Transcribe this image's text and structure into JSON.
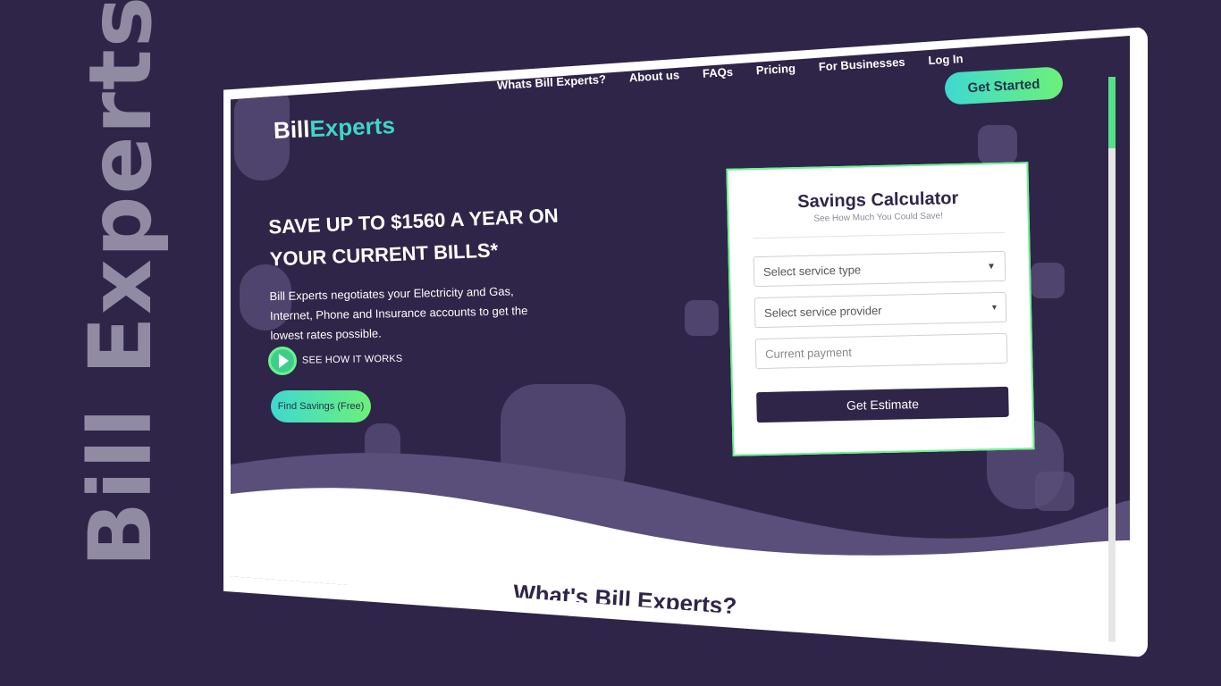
{
  "side_title": "Bill Experts",
  "logo": {
    "part1": "Bill",
    "part2": "Experts"
  },
  "nav": {
    "items": [
      "Whats Bill Experts?",
      "About us",
      "FAQs",
      "Pricing",
      "For Businesses",
      "Log In"
    ],
    "cta": "Get Started"
  },
  "hero": {
    "headline": "SAVE UP TO $1560 A YEAR ON YOUR CURRENT BILLS*",
    "description": "Bill Experts negotiates your Electricity and Gas, Internet, Phone and Insurance accounts to get the lowest rates possible.",
    "play_label": "SEE HOW IT WORKS",
    "find_button": "Find Savings (Free)"
  },
  "calculator": {
    "title": "Savings Calculator",
    "subtitle": "See How Much You Could Save!",
    "service_type": "Select service type",
    "service_provider": "Select service provider",
    "payment_placeholder": "Current payment",
    "button": "Get Estimate"
  },
  "section_title": "What's Bill Experts?",
  "colors": {
    "background": "#2f2548",
    "accent": "#3ed9d0",
    "accent2": "#6cf07a"
  }
}
